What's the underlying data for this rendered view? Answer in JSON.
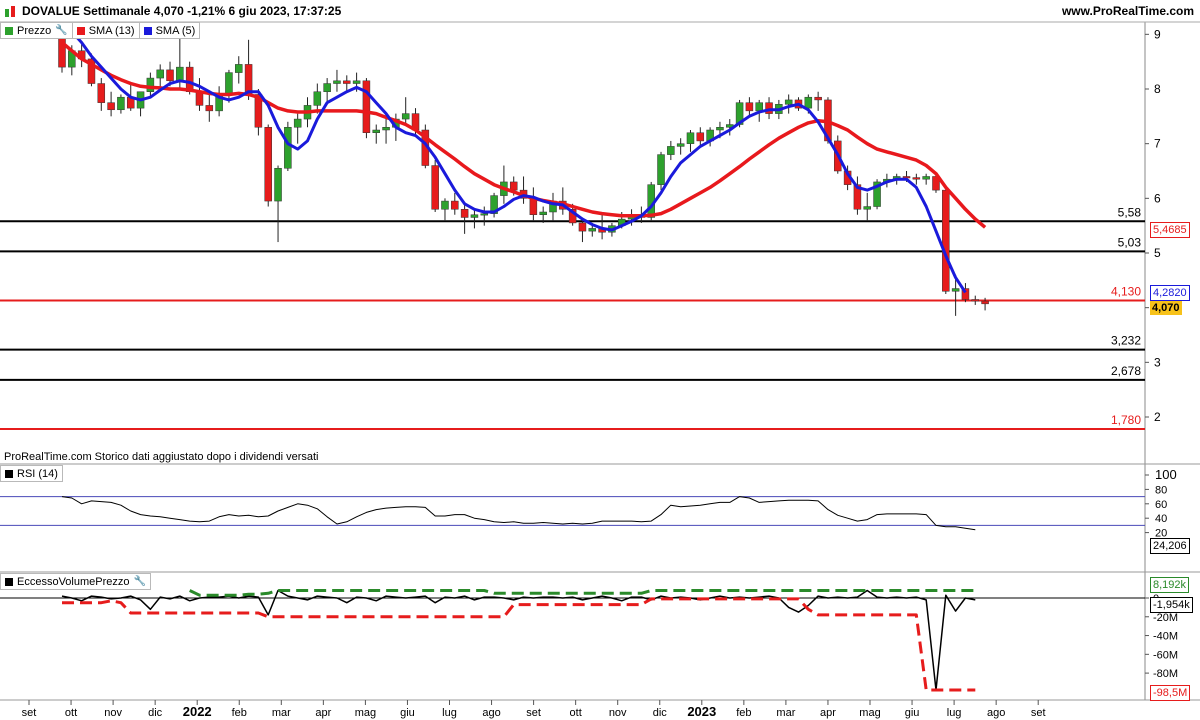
{
  "header": {
    "title": "DOVALUE Settimanale 4,070 -1,21% 6 giu 2023, 17:37:25",
    "site": "www.ProRealTime.com"
  },
  "legend": [
    {
      "label": "Prezzo",
      "color": "#2a8a2a",
      "icon": "wrench-icon"
    },
    {
      "label": "SMA (13)",
      "color": "#e8191d"
    },
    {
      "label": "SMA (5)",
      "color": "#1a1adb"
    }
  ],
  "disclaimer": "ProRealTime.com  Storico dati aggiustato dopo i dividendi versati",
  "rsi_pane": {
    "label": "RSI (14)",
    "value_label": "24,206"
  },
  "volume_pane": {
    "label": "EccessoVolumePrezzo",
    "green_label": "8,192k",
    "black_label": "-1,954k",
    "red_label": "-98,5M"
  },
  "price_labels": {
    "current": "4,070",
    "sma5": "4,2820",
    "sma13": "5,4685"
  },
  "colors": {
    "up": "#2da12d",
    "down": "#e61c1c",
    "sma13": "#e8191d",
    "sma5": "#1a1adb",
    "level_black": "#000000",
    "level_red": "#e61c1c",
    "current_tag": "#f7c21a"
  },
  "chart_data": [
    {
      "type": "candlestick",
      "title": "DOVALUE Settimanale",
      "y_ticks": [
        "2",
        "3",
        "4",
        "5",
        "6",
        "7",
        "8",
        "9"
      ],
      "ylim": [
        1.45,
        9.1
      ],
      "x_ticks": [
        "set",
        "ott",
        "nov",
        "dic",
        "2022",
        "feb",
        "mar",
        "apr",
        "mag",
        "giu",
        "lug",
        "ago",
        "set",
        "ott",
        "nov",
        "dic",
        "2023",
        "feb",
        "mar",
        "apr",
        "mag",
        "giu",
        "lug",
        "ago",
        "set"
      ],
      "x_bold": [
        "2022",
        "2023"
      ],
      "levels": [
        {
          "value": 5.58,
          "label": "5,58",
          "color": "black"
        },
        {
          "value": 5.03,
          "label": "5,03",
          "color": "black"
        },
        {
          "value": 4.13,
          "label": "4,130",
          "color": "red"
        },
        {
          "value": 3.232,
          "label": "3,232",
          "color": "black"
        },
        {
          "value": 2.678,
          "label": "2,678",
          "color": "black"
        },
        {
          "value": 1.78,
          "label": "1,780",
          "color": "red"
        }
      ],
      "candles": [
        [
          8.95,
          9.1,
          8.3,
          8.4
        ],
        [
          8.4,
          8.8,
          8.25,
          8.7
        ],
        [
          8.7,
          8.85,
          8.4,
          8.55
        ],
        [
          8.55,
          8.65,
          8.05,
          8.1
        ],
        [
          8.1,
          8.2,
          7.6,
          7.75
        ],
        [
          7.75,
          7.95,
          7.5,
          7.62
        ],
        [
          7.62,
          7.9,
          7.55,
          7.85
        ],
        [
          7.85,
          8.1,
          7.6,
          7.65
        ],
        [
          7.65,
          7.95,
          7.5,
          7.95
        ],
        [
          7.95,
          8.3,
          7.85,
          8.2
        ],
        [
          8.2,
          8.45,
          8.0,
          8.35
        ],
        [
          8.35,
          8.5,
          8.05,
          8.15
        ],
        [
          8.15,
          9.0,
          8.0,
          8.4
        ],
        [
          8.4,
          8.5,
          7.9,
          7.95
        ],
        [
          7.95,
          8.2,
          7.6,
          7.7
        ],
        [
          7.7,
          7.9,
          7.4,
          7.6
        ],
        [
          7.6,
          8.05,
          7.5,
          7.9
        ],
        [
          7.9,
          8.35,
          7.75,
          8.3
        ],
        [
          8.3,
          8.6,
          8.1,
          8.45
        ],
        [
          8.45,
          8.9,
          7.8,
          7.9
        ],
        [
          7.9,
          8.0,
          7.15,
          7.3
        ],
        [
          7.3,
          7.35,
          5.85,
          5.95
        ],
        [
          5.95,
          6.6,
          5.2,
          6.55
        ],
        [
          6.55,
          7.4,
          6.5,
          7.3
        ],
        [
          7.3,
          7.55,
          7.0,
          7.45
        ],
        [
          7.45,
          7.85,
          7.3,
          7.7
        ],
        [
          7.7,
          8.1,
          7.55,
          7.95
        ],
        [
          7.95,
          8.2,
          7.75,
          8.1
        ],
        [
          8.1,
          8.35,
          7.95,
          8.15
        ],
        [
          8.15,
          8.25,
          7.95,
          8.1
        ],
        [
          8.1,
          8.3,
          7.95,
          8.15
        ],
        [
          8.15,
          8.2,
          7.1,
          7.2
        ],
        [
          7.2,
          7.35,
          7.0,
          7.25
        ],
        [
          7.25,
          7.5,
          7.0,
          7.3
        ],
        [
          7.3,
          7.55,
          7.05,
          7.45
        ],
        [
          7.45,
          7.85,
          7.35,
          7.55
        ],
        [
          7.55,
          7.65,
          7.15,
          7.25
        ],
        [
          7.25,
          7.35,
          6.55,
          6.6
        ],
        [
          6.6,
          6.7,
          5.75,
          5.8
        ],
        [
          5.8,
          6.0,
          5.6,
          5.95
        ],
        [
          5.95,
          6.1,
          5.7,
          5.8
        ],
        [
          5.8,
          5.9,
          5.35,
          5.65
        ],
        [
          5.65,
          5.8,
          5.45,
          5.7
        ],
        [
          5.7,
          5.85,
          5.5,
          5.72
        ],
        [
          5.72,
          6.1,
          5.65,
          6.05
        ],
        [
          6.05,
          6.6,
          5.9,
          6.3
        ],
        [
          6.3,
          6.4,
          6.05,
          6.15
        ],
        [
          6.15,
          6.4,
          5.9,
          6.0
        ],
        [
          6.0,
          6.2,
          5.6,
          5.7
        ],
        [
          5.7,
          5.85,
          5.55,
          5.75
        ],
        [
          5.75,
          6.1,
          5.6,
          5.95
        ],
        [
          5.95,
          6.2,
          5.7,
          5.8
        ],
        [
          5.8,
          5.9,
          5.5,
          5.55
        ],
        [
          5.55,
          5.65,
          5.2,
          5.4
        ],
        [
          5.4,
          5.55,
          5.3,
          5.45
        ],
        [
          5.45,
          5.7,
          5.25,
          5.38
        ],
        [
          5.38,
          5.55,
          5.3,
          5.5
        ],
        [
          5.5,
          5.75,
          5.45,
          5.62
        ],
        [
          5.62,
          5.8,
          5.5,
          5.7
        ],
        [
          5.7,
          5.85,
          5.55,
          5.65
        ],
        [
          5.65,
          6.3,
          5.6,
          6.25
        ],
        [
          6.25,
          6.85,
          6.15,
          6.8
        ],
        [
          6.8,
          7.05,
          6.7,
          6.95
        ],
        [
          6.95,
          7.1,
          6.8,
          7.0
        ],
        [
          7.0,
          7.25,
          6.85,
          7.2
        ],
        [
          7.2,
          7.3,
          6.95,
          7.05
        ],
        [
          7.05,
          7.3,
          6.95,
          7.25
        ],
        [
          7.25,
          7.4,
          7.1,
          7.3
        ],
        [
          7.3,
          7.45,
          7.15,
          7.35
        ],
        [
          7.35,
          7.8,
          7.3,
          7.75
        ],
        [
          7.75,
          7.85,
          7.5,
          7.6
        ],
        [
          7.6,
          7.8,
          7.4,
          7.75
        ],
        [
          7.75,
          7.85,
          7.45,
          7.55
        ],
        [
          7.55,
          7.8,
          7.45,
          7.72
        ],
        [
          7.72,
          7.9,
          7.55,
          7.8
        ],
        [
          7.8,
          7.85,
          7.6,
          7.65
        ],
        [
          7.65,
          7.9,
          7.55,
          7.85
        ],
        [
          7.85,
          7.95,
          7.6,
          7.8
        ],
        [
          7.8,
          7.85,
          7.0,
          7.05
        ],
        [
          7.05,
          7.15,
          6.45,
          6.5
        ],
        [
          6.5,
          6.6,
          6.15,
          6.25
        ],
        [
          6.25,
          6.4,
          5.7,
          5.8
        ],
        [
          5.8,
          6.1,
          5.6,
          5.85
        ],
        [
          5.85,
          6.35,
          5.8,
          6.3
        ],
        [
          6.3,
          6.45,
          6.2,
          6.35
        ],
        [
          6.35,
          6.45,
          6.25,
          6.4
        ],
        [
          6.4,
          6.5,
          6.3,
          6.38
        ],
        [
          6.38,
          6.45,
          6.25,
          6.35
        ],
        [
          6.35,
          6.45,
          6.25,
          6.4
        ],
        [
          6.4,
          6.45,
          6.1,
          6.15
        ],
        [
          6.15,
          6.2,
          4.25,
          4.3
        ],
        [
          4.3,
          4.6,
          3.85,
          4.35
        ],
        [
          4.35,
          4.45,
          4.1,
          4.15
        ],
        [
          4.15,
          4.22,
          4.05,
          4.12
        ],
        [
          4.12,
          4.18,
          3.95,
          4.07
        ]
      ],
      "sma13": [
        8.85,
        8.7,
        8.55,
        8.45,
        8.35,
        8.25,
        8.17,
        8.1,
        8.05,
        8.03,
        8.02,
        8.0,
        8.0,
        7.98,
        7.95,
        7.92,
        7.9,
        7.9,
        7.92,
        7.9,
        7.85,
        7.75,
        7.65,
        7.6,
        7.58,
        7.58,
        7.6,
        7.6,
        7.6,
        7.6,
        7.6,
        7.58,
        7.55,
        7.48,
        7.42,
        7.35,
        7.25,
        7.12,
        6.98,
        6.85,
        6.72,
        6.58,
        6.45,
        6.35,
        6.25,
        6.18,
        6.12,
        6.05,
        6.0,
        5.96,
        5.93,
        5.9,
        5.85,
        5.8,
        5.75,
        5.72,
        5.7,
        5.68,
        5.68,
        5.68,
        5.69,
        5.72,
        5.8,
        5.9,
        6.0,
        6.1,
        6.2,
        6.32,
        6.45,
        6.58,
        6.72,
        6.85,
        6.98,
        7.1,
        7.2,
        7.3,
        7.38,
        7.42,
        7.4,
        7.33,
        7.25,
        7.12,
        7.0,
        6.9,
        6.85,
        6.8,
        6.75,
        6.7,
        6.6,
        6.45,
        6.2,
        6.0,
        5.8,
        5.62,
        5.47
      ],
      "sma5": [
        null,
        9.05,
        8.85,
        8.6,
        8.4,
        8.2,
        8.0,
        7.85,
        7.8,
        7.85,
        7.98,
        8.1,
        8.15,
        8.12,
        8.05,
        7.95,
        7.85,
        7.8,
        7.85,
        7.95,
        7.95,
        7.7,
        7.3,
        7.0,
        6.9,
        7.05,
        7.45,
        7.75,
        7.85,
        7.95,
        8.03,
        7.95,
        7.75,
        7.55,
        7.3,
        7.2,
        7.15,
        7.0,
        6.75,
        6.45,
        6.15,
        5.9,
        5.8,
        5.75,
        5.75,
        5.85,
        5.98,
        6.05,
        6.02,
        5.95,
        5.9,
        5.88,
        5.75,
        5.62,
        5.52,
        5.45,
        5.42,
        5.5,
        5.58,
        5.68,
        5.85,
        6.1,
        6.4,
        6.65,
        6.8,
        6.95,
        7.05,
        7.15,
        7.25,
        7.38,
        7.5,
        7.58,
        7.62,
        7.62,
        7.68,
        7.72,
        7.62,
        7.4,
        7.1,
        6.8,
        6.45,
        6.2,
        6.15,
        6.22,
        6.3,
        6.35,
        6.35,
        6.2,
        5.85,
        5.4,
        4.95,
        4.55,
        4.28
      ]
    },
    {
      "type": "line",
      "title": "RSI (14)",
      "y_ticks": [
        "100",
        "80",
        "60",
        "40",
        "20"
      ],
      "ylim": [
        0,
        100
      ],
      "reference_lines": [
        70,
        30
      ],
      "values": [
        70,
        68,
        60,
        64,
        63,
        62,
        58,
        50,
        45,
        43,
        42,
        40,
        38,
        36,
        35,
        36,
        42,
        45,
        43,
        44,
        42,
        43,
        50,
        55,
        60,
        58,
        53,
        42,
        32,
        35,
        42,
        48,
        52,
        54,
        55,
        56,
        56,
        55,
        43,
        43,
        45,
        45,
        40,
        38,
        35,
        34,
        35,
        33,
        33,
        34,
        33,
        32,
        33,
        32,
        33,
        36,
        36,
        36,
        36,
        35,
        36,
        45,
        58,
        56,
        57,
        58,
        60,
        62,
        62,
        70,
        68,
        62,
        63,
        64,
        65,
        65,
        65,
        64,
        52,
        44,
        40,
        36,
        38,
        45,
        46,
        46,
        46,
        46,
        45,
        30,
        28,
        28,
        26,
        24
      ]
    },
    {
      "type": "line",
      "title": "EccessoVolumePrezzo",
      "y_ticks": [
        "0",
        "-20M",
        "-40M",
        "-60M",
        "-80M"
      ],
      "ylim": [
        -100,
        12
      ],
      "series": [
        {
          "name": "black",
          "values": [
            2,
            0,
            -3,
            2,
            1,
            -1,
            0,
            2,
            -2,
            -12,
            1,
            -1,
            2,
            -3,
            0,
            1,
            1,
            2,
            0,
            2,
            1,
            -18,
            8,
            2,
            0,
            -2,
            2,
            1,
            0,
            -5,
            1,
            0,
            -3,
            2,
            1,
            0,
            1,
            2,
            -5,
            1,
            0,
            2,
            -2,
            1,
            1,
            0,
            -2,
            1,
            0,
            1,
            1,
            0,
            1,
            -2,
            0,
            2,
            0,
            -3,
            1,
            1,
            -2,
            2,
            0,
            1,
            0,
            -2,
            0,
            2,
            0,
            1,
            0,
            1,
            2,
            0,
            -10,
            -15,
            -8,
            2,
            0,
            1,
            0,
            1,
            8,
            1,
            0,
            1,
            0,
            1,
            -2,
            -98,
            3,
            -14,
            0,
            -2
          ]
        },
        {
          "name": "green",
          "values": [
            null,
            null,
            null,
            null,
            null,
            null,
            null,
            null,
            null,
            null,
            null,
            null,
            null,
            8,
            3,
            3,
            3,
            3,
            3,
            4,
            4,
            5,
            8,
            8,
            8,
            8,
            8,
            8,
            8,
            8,
            8,
            8,
            8,
            8,
            8,
            8,
            8,
            8,
            8,
            8,
            8,
            8,
            8,
            8,
            5,
            5,
            5,
            5,
            5,
            5,
            5,
            5,
            5,
            5,
            5,
            5,
            5,
            5,
            5,
            5,
            8,
            8,
            8,
            8,
            8,
            8,
            8,
            8,
            8,
            8,
            8,
            8,
            8,
            8,
            8,
            8,
            8,
            8,
            8,
            8,
            8,
            8,
            8,
            8,
            8,
            8,
            8,
            8,
            8,
            8,
            8,
            8,
            8,
            8
          ]
        },
        {
          "name": "red",
          "values": [
            -5,
            -5,
            -5,
            -5,
            -5,
            -3,
            -5,
            -16,
            -16,
            -16,
            -16,
            -16,
            -16,
            -16,
            -16,
            -16,
            -16,
            -16,
            -16,
            -16,
            -16,
            -20,
            -20,
            -20,
            -20,
            -20,
            -20,
            -20,
            -20,
            -20,
            -20,
            -20,
            -20,
            -20,
            -20,
            -20,
            -20,
            -20,
            -20,
            -20,
            -20,
            -20,
            -20,
            -20,
            -20,
            -20,
            -7,
            -7,
            -7,
            -7,
            -7,
            -7,
            -7,
            -7,
            -7,
            -7,
            -7,
            -7,
            -7,
            -7,
            -1,
            -1,
            -1,
            -1,
            -1,
            -1,
            -1,
            -1,
            -1,
            -1,
            -1,
            -1,
            -1,
            -1,
            -1,
            -1,
            -12,
            -18,
            -18,
            -18,
            -18,
            -18,
            -18,
            -18,
            -18,
            -18,
            -18,
            -18,
            -98,
            -98,
            -98,
            -98,
            -98,
            -98
          ]
        }
      ]
    }
  ]
}
